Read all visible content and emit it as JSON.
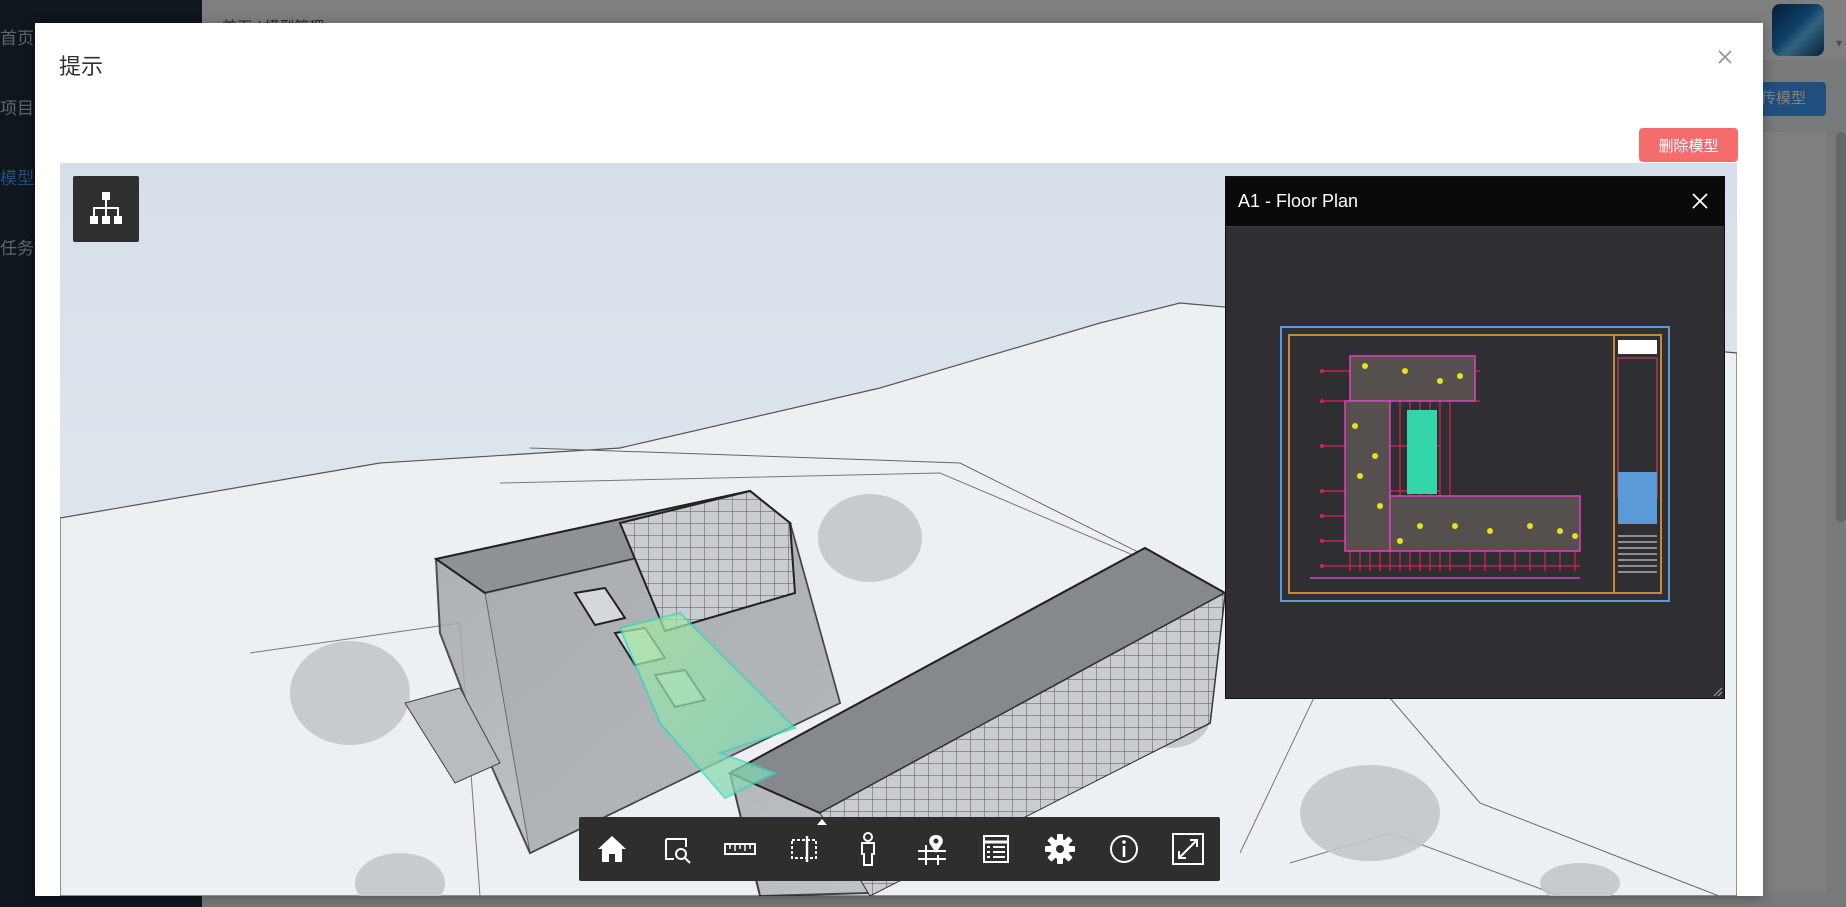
{
  "background_app": {
    "nav": [
      "首页",
      "项目",
      "模型",
      "任务"
    ],
    "breadcrumb": "首页 / 模型管理",
    "upload_label": "上传模型"
  },
  "dialog": {
    "title": "提示",
    "delete_label": "删除模型"
  },
  "viewer": {
    "sheet_panel": {
      "title": "A1 - Floor Plan"
    },
    "toolbar": [
      {
        "name": "home",
        "icon": "home-icon"
      },
      {
        "name": "zoom-window",
        "icon": "zoom-window-icon"
      },
      {
        "name": "measure",
        "icon": "ruler-icon"
      },
      {
        "name": "section",
        "icon": "section-box-icon"
      },
      {
        "name": "first-person",
        "icon": "person-icon"
      },
      {
        "name": "explode",
        "icon": "location-icon"
      },
      {
        "name": "properties",
        "icon": "list-icon"
      },
      {
        "name": "settings",
        "icon": "gear-icon"
      },
      {
        "name": "info",
        "icon": "info-icon"
      },
      {
        "name": "fullscreen",
        "icon": "fullscreen-icon"
      }
    ]
  },
  "colors": {
    "accent": "#409eff",
    "danger": "#f56c6c",
    "toolbar_bg": "#2e2e2e",
    "highlight": "#7ee0b0"
  }
}
